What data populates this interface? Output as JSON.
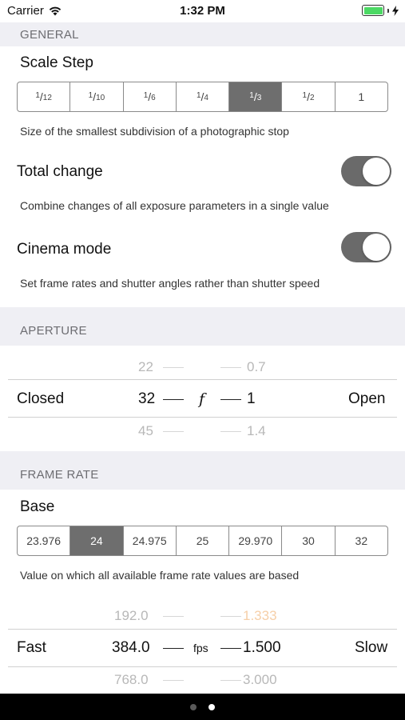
{
  "status": {
    "carrier": "Carrier",
    "time": "1:32 PM",
    "icons": [
      "wifi-icon",
      "battery-icon",
      "charging-bolt-icon"
    ]
  },
  "general": {
    "header": "GENERAL",
    "scale_step": {
      "title": "Scale Step",
      "options": [
        {
          "num": "1",
          "den": "12"
        },
        {
          "num": "1",
          "den": "10"
        },
        {
          "num": "1",
          "den": "6"
        },
        {
          "num": "1",
          "den": "4"
        },
        {
          "num": "1",
          "den": "3"
        },
        {
          "num": "1",
          "den": "2"
        },
        {
          "num": "1",
          "den": ""
        }
      ],
      "selected_index": 4,
      "description": "Size of the smallest subdivision of a photographic stop"
    },
    "total_change": {
      "title": "Total change",
      "on": true,
      "description": "Combine changes of all exposure parameters in a single value"
    },
    "cinema_mode": {
      "title": "Cinema mode",
      "on": true,
      "description": "Set frame rates and shutter angles rather than shutter speed"
    }
  },
  "aperture": {
    "header": "APERTURE",
    "left_label": "Closed",
    "right_label": "Open",
    "center_symbol": "f",
    "left_values": {
      "above": "22",
      "current": "32",
      "below": "45"
    },
    "right_values": {
      "above": "0.7",
      "current": "1",
      "below": "1.4"
    }
  },
  "frame_rate": {
    "header": "FRAME RATE",
    "base_title": "Base",
    "options": [
      "23.976",
      "24",
      "24.975",
      "25",
      "29.970",
      "30",
      "32"
    ],
    "selected_index": 1,
    "description": "Value on which all available frame rate values are based",
    "left_label": "Fast",
    "right_label": "Slow",
    "center_symbol": "fps",
    "left_values": {
      "above": "192.0",
      "current": "384.0",
      "below": "768.0"
    },
    "right_values": {
      "above": "1.333",
      "current": "1.500",
      "below": "3.000"
    }
  },
  "page_indicator": {
    "count": 2,
    "current": 1
  },
  "colors": {
    "section_bg": "#efeff4",
    "selected_segment": "#6e6e6e",
    "toggle_on": "#6a6a6a",
    "battery": "#4cd964",
    "highlight_value": "#f6cfa8"
  }
}
